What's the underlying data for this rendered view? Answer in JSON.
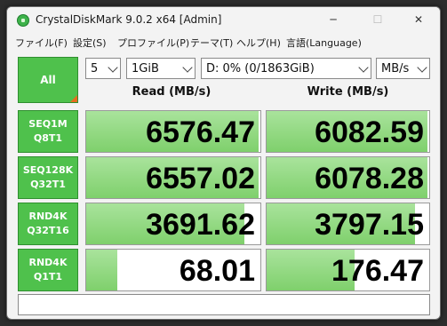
{
  "window": {
    "title": "CrystalDiskMark 9.0.2 x64 [Admin]",
    "controls": {
      "minimize": "─",
      "maximize": "☐",
      "close": "✕"
    }
  },
  "menu": [
    "ファイル(F)",
    "設定(S)",
    "プロファイル(P)",
    "テーマ(T)",
    "ヘルプ(H)",
    "言語(Language)"
  ],
  "toolbar": {
    "all_label": "All",
    "count": "5",
    "size": "1GiB",
    "drive": "D: 0% (0/1863GiB)",
    "unit": "MB/s"
  },
  "columns": {
    "read": "Read (MB/s)",
    "write": "Write (MB/s)"
  },
  "tests": [
    {
      "line1": "SEQ1M",
      "line2": "Q8T1",
      "read": "6576.47",
      "write": "6082.59",
      "read_fill": 0.99,
      "write_fill": 0.99
    },
    {
      "line1": "SEQ128K",
      "line2": "Q32T1",
      "read": "6557.02",
      "write": "6078.28",
      "read_fill": 0.99,
      "write_fill": 0.99
    },
    {
      "line1": "RND4K",
      "line2": "Q32T16",
      "read": "3691.62",
      "write": "3797.15",
      "read_fill": 0.91,
      "write_fill": 0.91
    },
    {
      "line1": "RND4K",
      "line2": "Q1T1",
      "read": "68.01",
      "write": "176.47",
      "read_fill": 0.18,
      "write_fill": 0.54
    }
  ],
  "comment": "",
  "colors": {
    "accent_green": "#4fc14c",
    "bar_green": "#7fd06c",
    "corner_orange": "#e86b1f"
  },
  "icons": {
    "app": "crystaldiskmark-disk-icon"
  }
}
